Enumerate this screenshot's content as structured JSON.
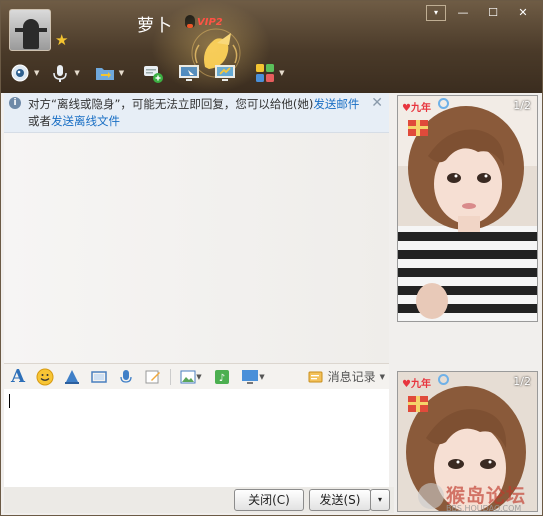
{
  "header": {
    "contact_name": "萝卜",
    "vip_label": "VIP2",
    "window_buttons": {
      "dropdown": "▾",
      "minimize": "—",
      "maximize": "☐",
      "close": "✕"
    }
  },
  "toolbar_top": {
    "items": [
      {
        "icon": "video-call-icon"
      },
      {
        "icon": "voice-call-icon"
      },
      {
        "icon": "file-transfer-icon"
      },
      {
        "icon": "create-group-icon"
      },
      {
        "icon": "remote-assist-icon"
      },
      {
        "icon": "screen-share-icon"
      },
      {
        "icon": "apps-icon"
      }
    ]
  },
  "notice": {
    "text_before": "对方“离线或隐身”，可能无法立即回复，您可以给他(她)",
    "link_mail": "发送邮件",
    "text_mid": "或者",
    "link_file": "发送离线文件"
  },
  "photos": {
    "page_indicator": "1/2",
    "tag": "♥九年"
  },
  "input_toolbar": {
    "history_label": "消息记录"
  },
  "buttons": {
    "close": "关闭(C)",
    "send": "发送(S)",
    "more": "▾"
  },
  "watermark": {
    "main": "猴岛论坛",
    "sub": "BBS.HOUDAO.COM"
  },
  "colors": {
    "header_dark": "#4a3a29",
    "link": "#1a6fc4",
    "notice_bg": "#e7eef6"
  }
}
